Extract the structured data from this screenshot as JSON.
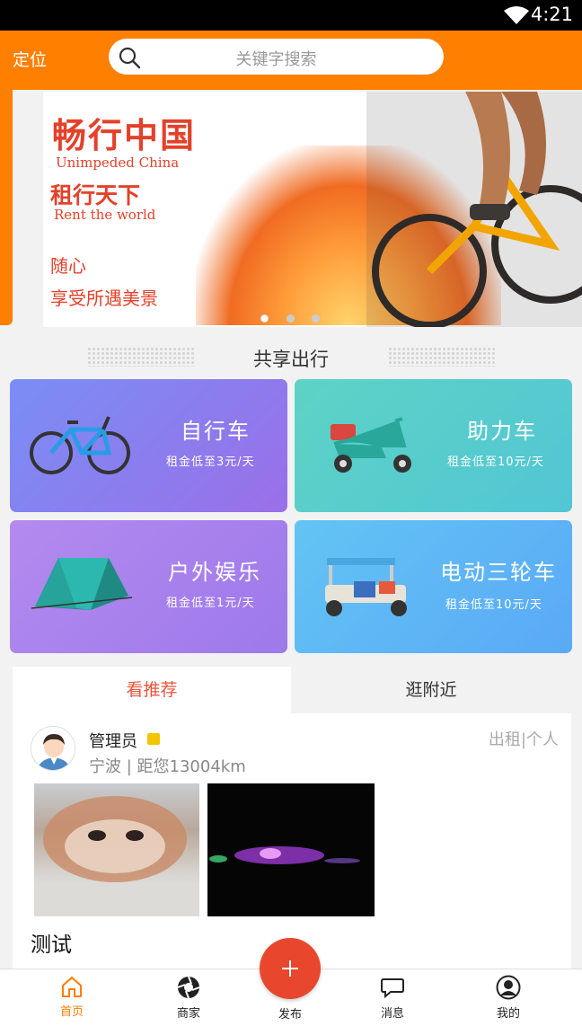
{
  "status_bar": {
    "time": "4:21"
  },
  "header": {
    "location_label": "定位",
    "search_placeholder": "关键字搜索"
  },
  "banner": {
    "title_cn": "畅行中国",
    "title_en": "Unimpeded China",
    "subtitle_cn": "租行天下",
    "subtitle_en": "Rent the world",
    "line3": "随心",
    "line4": "享受所遇美景",
    "active_slide": 1,
    "slide_count": 3
  },
  "section_title": "共享出行",
  "categories": [
    {
      "name": "自行车",
      "price": "租金低至3元/天",
      "icon": "bicycle-icon",
      "color": "#8a78f0"
    },
    {
      "name": "助力车",
      "price": "租金低至10元/天",
      "icon": "scooter-icon",
      "color": "#56cfc9"
    },
    {
      "name": "户外娱乐",
      "price": "租金低至1元/天",
      "icon": "tent-icon",
      "color": "#a881ef"
    },
    {
      "name": "电动三轮车",
      "price": "租金低至10元/天",
      "icon": "tuktuk-icon",
      "color": "#5fb6f5"
    }
  ],
  "tabs": {
    "recommend": "看推荐",
    "nearby": "逛附近"
  },
  "post": {
    "username": "管理员",
    "location": "宁波 | 距您13004km",
    "type": "出租|个人",
    "title": "测试"
  },
  "bottom_nav": {
    "home": "首页",
    "merchants": "商家",
    "publish": "发布",
    "messages": "消息",
    "mine": "我的"
  },
  "colors": {
    "brand_orange": "#ff7f00",
    "accent_red": "#e8472e"
  }
}
